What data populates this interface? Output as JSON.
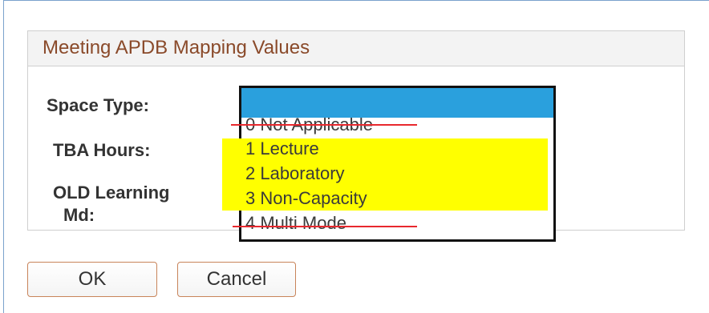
{
  "panel": {
    "title": "Meeting APDB Mapping Values"
  },
  "fields": {
    "space_type_label": "Space Type:",
    "tba_hours_label": "TBA Hours:",
    "old_learning_label_line1": "OLD Learning",
    "old_learning_label_line2": "Md:"
  },
  "dropdown": {
    "selected_value": "",
    "options": [
      "0 Not Applicable",
      "1 Lecture",
      "2 Laboratory",
      "3 Non-Capacity",
      "4 Multi Mode"
    ],
    "struck_options": [
      "0 Not Applicable",
      "4 Multi Mode"
    ],
    "highlighted_options": [
      "1 Lecture",
      "2 Laboratory",
      "3 Non-Capacity"
    ]
  },
  "buttons": {
    "ok_label": "OK",
    "cancel_label": "Cancel"
  },
  "colors": {
    "title": "#8a4a2a",
    "selection": "#2aa0dd",
    "highlight": "#ffff00",
    "strike": "#e8282e",
    "button_border": "#c8845a"
  }
}
